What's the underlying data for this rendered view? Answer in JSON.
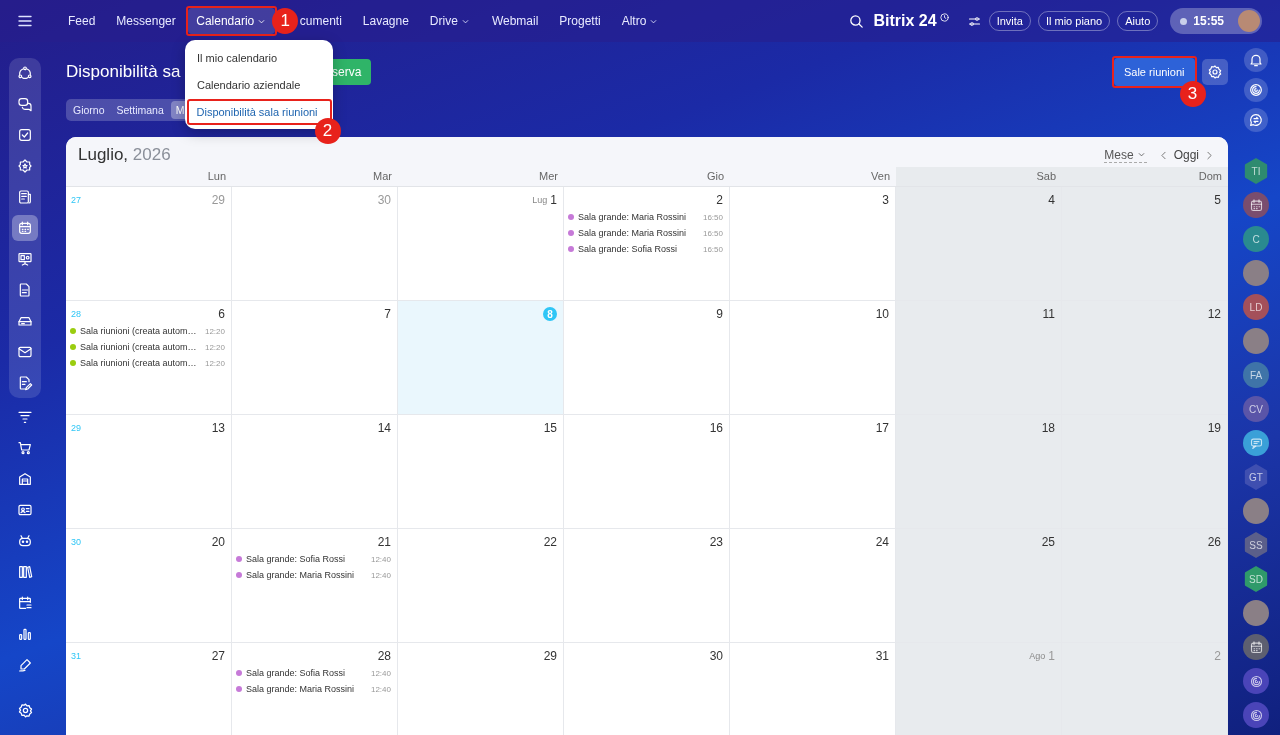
{
  "topbar": {
    "nav": [
      {
        "label": "Feed",
        "selected": false,
        "dropdown": false
      },
      {
        "label": "Messenger",
        "selected": false,
        "dropdown": false
      },
      {
        "label": "Calendario",
        "selected": true,
        "dropdown": true,
        "annotation": "1"
      },
      {
        "label": "cumenti",
        "selected": false,
        "dropdown": false
      },
      {
        "label": "Lavagne",
        "selected": false,
        "dropdown": false
      },
      {
        "label": "Drive",
        "selected": false,
        "dropdown": true
      },
      {
        "label": "Webmail",
        "selected": false,
        "dropdown": false
      },
      {
        "label": "Progetti",
        "selected": false,
        "dropdown": false
      },
      {
        "label": "Altro",
        "selected": false,
        "dropdown": true
      }
    ],
    "brand": "Bitrix 24",
    "buttons": [
      "Invita",
      "Il mio piano",
      "Aiuto"
    ],
    "clock": "15:55"
  },
  "left_sidebar": {
    "groups": [
      {
        "kind": "panel",
        "items": [
          {
            "selected": false
          },
          {
            "selected": false
          },
          {
            "selected": false
          },
          {
            "selected": false
          },
          {
            "selected": false
          },
          {
            "selected": true
          },
          {
            "selected": false
          },
          {
            "selected": false
          },
          {
            "selected": false
          },
          {
            "selected": false
          },
          {
            "selected": false
          }
        ]
      },
      {
        "kind": "plain",
        "items": [
          {
            "selected": false
          },
          {
            "selected": false
          },
          {
            "selected": false
          },
          {
            "selected": false
          },
          {
            "selected": false
          },
          {
            "selected": false
          },
          {
            "selected": false
          },
          {
            "selected": false
          },
          {
            "selected": false
          }
        ]
      }
    ]
  },
  "page": {
    "title": "Disponibilità sa",
    "primary_button": "serva",
    "view_tabs": [
      {
        "label": "Giorno",
        "selected": false
      },
      {
        "label": "Settimana",
        "selected": false
      },
      {
        "label": "M",
        "selected": true
      }
    ],
    "rooms_button": {
      "label": "Sale riunioni",
      "annotation": "3"
    }
  },
  "menu": {
    "items": [
      {
        "label": "Il mio calendario",
        "selected": false
      },
      {
        "label": "Calendario aziendale",
        "selected": false
      },
      {
        "label": "Disponibilità sala riunioni",
        "selected": true,
        "annotation": "2"
      }
    ]
  },
  "calendar": {
    "month": "Luglio,",
    "year": "2026",
    "view_select": "Mese",
    "today_button": "Oggi",
    "weekdays": [
      {
        "label": "Lun",
        "weekend": false
      },
      {
        "label": "Mar",
        "weekend": false
      },
      {
        "label": "Mer",
        "weekend": false
      },
      {
        "label": "Gio",
        "weekend": false
      },
      {
        "label": "Ven",
        "weekend": false
      },
      {
        "label": "Sab",
        "weekend": true
      },
      {
        "label": "Dom",
        "weekend": true
      }
    ],
    "weeks": [
      {
        "number": "27",
        "days": [
          {
            "day": "29",
            "faded": true,
            "today": false
          },
          {
            "day": "30",
            "faded": true,
            "today": false
          },
          {
            "day": "1",
            "month": "Lug",
            "faded": false,
            "today": false
          },
          {
            "day": "2",
            "faded": false,
            "today": false,
            "events": [
              {
                "title": "Sala grande: Maria Rossini",
                "time": "16:50",
                "color": "#c67ad8"
              },
              {
                "title": "Sala grande: Maria Rossini",
                "time": "16:50",
                "color": "#c67ad8"
              },
              {
                "title": "Sala grande: Sofia Rossi",
                "time": "16:50",
                "color": "#c67ad8"
              }
            ]
          },
          {
            "day": "3",
            "faded": false,
            "today": false
          },
          {
            "day": "4",
            "faded": false,
            "today": false
          },
          {
            "day": "5",
            "faded": false,
            "today": false
          }
        ]
      },
      {
        "number": "28",
        "days": [
          {
            "day": "6",
            "faded": false,
            "today": false,
            "events": [
              {
                "title": "Sala riunioni (creata autom…",
                "time": "12:20",
                "color": "#9acd0f"
              },
              {
                "title": "Sala riunioni (creata autom…",
                "time": "12:20",
                "color": "#9acd0f"
              },
              {
                "title": "Sala riunioni (creata autom…",
                "time": "12:20",
                "color": "#9acd0f"
              }
            ]
          },
          {
            "day": "7",
            "faded": false,
            "today": false
          },
          {
            "day": "8",
            "faded": false,
            "today": true
          },
          {
            "day": "9",
            "faded": false,
            "today": false
          },
          {
            "day": "10",
            "faded": false,
            "today": false
          },
          {
            "day": "11",
            "faded": false,
            "today": false
          },
          {
            "day": "12",
            "faded": false,
            "today": false
          }
        ]
      },
      {
        "number": "29",
        "days": [
          {
            "day": "13",
            "faded": false,
            "today": false
          },
          {
            "day": "14",
            "faded": false,
            "today": false
          },
          {
            "day": "15",
            "faded": false,
            "today": false
          },
          {
            "day": "16",
            "faded": false,
            "today": false
          },
          {
            "day": "17",
            "faded": false,
            "today": false
          },
          {
            "day": "18",
            "faded": false,
            "today": false
          },
          {
            "day": "19",
            "faded": false,
            "today": false
          }
        ]
      },
      {
        "number": "30",
        "days": [
          {
            "day": "20",
            "faded": false,
            "today": false
          },
          {
            "day": "21",
            "faded": false,
            "today": false,
            "events": [
              {
                "title": "Sala grande: Sofia Rossi",
                "time": "12:40",
                "color": "#c67ad8"
              },
              {
                "title": "Sala grande: Maria Rossini",
                "time": "12:40",
                "color": "#c67ad8"
              }
            ]
          },
          {
            "day": "22",
            "faded": false,
            "today": false
          },
          {
            "day": "23",
            "faded": false,
            "today": false
          },
          {
            "day": "24",
            "faded": false,
            "today": false
          },
          {
            "day": "25",
            "faded": false,
            "today": false
          },
          {
            "day": "26",
            "faded": false,
            "today": false
          }
        ]
      },
      {
        "number": "31",
        "days": [
          {
            "day": "27",
            "faded": false,
            "today": false
          },
          {
            "day": "28",
            "faded": false,
            "today": false,
            "events": [
              {
                "title": "Sala grande: Sofia Rossi",
                "time": "12:40",
                "color": "#c67ad8"
              },
              {
                "title": "Sala grande: Maria Rossini",
                "time": "12:40",
                "color": "#c67ad8"
              }
            ]
          },
          {
            "day": "29",
            "faded": false,
            "today": false
          },
          {
            "day": "30",
            "faded": false,
            "today": false
          },
          {
            "day": "31",
            "faded": false,
            "today": false
          },
          {
            "day": "1",
            "month": "Ago",
            "faded": true,
            "today": false
          },
          {
            "day": "2",
            "faded": true,
            "today": false
          }
        ]
      }
    ]
  },
  "right_sidebar": {
    "contacts": [
      {
        "kind": "hex",
        "initials": "TI",
        "color": "#2e8b6f"
      },
      {
        "kind": "calendar",
        "color": "#7a4d6e"
      },
      {
        "kind": "circle",
        "initials": "C",
        "color": "#2a8a8f"
      },
      {
        "kind": "photo"
      },
      {
        "kind": "circle",
        "initials": "LD",
        "color": "#a4505a"
      },
      {
        "kind": "photo"
      },
      {
        "kind": "circle",
        "initials": "FA",
        "color": "#3f74a8"
      },
      {
        "kind": "circle",
        "initials": "CV",
        "color": "#5a55a8"
      },
      {
        "kind": "chat",
        "color": "#3aa0d8"
      },
      {
        "kind": "hex",
        "initials": "GT",
        "color": "#3f4fb0"
      },
      {
        "kind": "photo"
      },
      {
        "kind": "hex",
        "initials": "SS",
        "color": "#5b5f8a"
      },
      {
        "kind": "hex",
        "initials": "SD",
        "color": "#2f9a6a"
      },
      {
        "kind": "photo"
      },
      {
        "kind": "calendar",
        "color": "#5d5f70"
      },
      {
        "kind": "swirl",
        "color": "#4a44b8"
      },
      {
        "kind": "swirl",
        "color": "#4a44b8"
      }
    ]
  }
}
